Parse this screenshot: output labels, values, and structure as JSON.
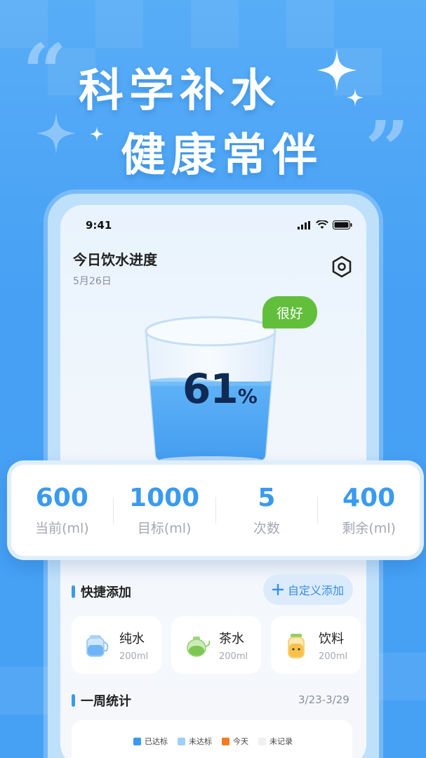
{
  "headline": {
    "line1": "科学补水",
    "line2": "健康常伴"
  },
  "status_bar": {
    "time": "9:41"
  },
  "header": {
    "title": "今日饮水进度",
    "date": "5月26日"
  },
  "progress": {
    "badge": "很好",
    "percent_value": "61",
    "percent_unit": "%",
    "fill_fraction": 0.61
  },
  "stats": [
    {
      "value": "600",
      "label": "当前(ml)"
    },
    {
      "value": "1000",
      "label": "目标(ml)"
    },
    {
      "value": "5",
      "label": "次数"
    },
    {
      "value": "400",
      "label": "剩余(ml)"
    }
  ],
  "quick_add": {
    "title": "快捷添加",
    "custom_button": "自定义添加",
    "items": [
      {
        "name": "纯水",
        "amount": "200ml",
        "icon": "kettle-icon"
      },
      {
        "name": "茶水",
        "amount": "200ml",
        "icon": "teapot-icon"
      },
      {
        "name": "饮料",
        "amount": "200ml",
        "icon": "juice-bottle-icon"
      }
    ]
  },
  "weekly": {
    "title": "一周统计",
    "range": "3/23-3/29",
    "legend": [
      {
        "label": "已达标",
        "color": "#3a9af0"
      },
      {
        "label": "未达标",
        "color": "#9ed0fb"
      },
      {
        "label": "今天",
        "color": "#f47b20"
      },
      {
        "label": "未记录",
        "color": "#eef0f3"
      }
    ]
  },
  "colors": {
    "accent": "#3a9af0",
    "good_badge": "#62bf3c",
    "background": "#4aa3f5"
  }
}
